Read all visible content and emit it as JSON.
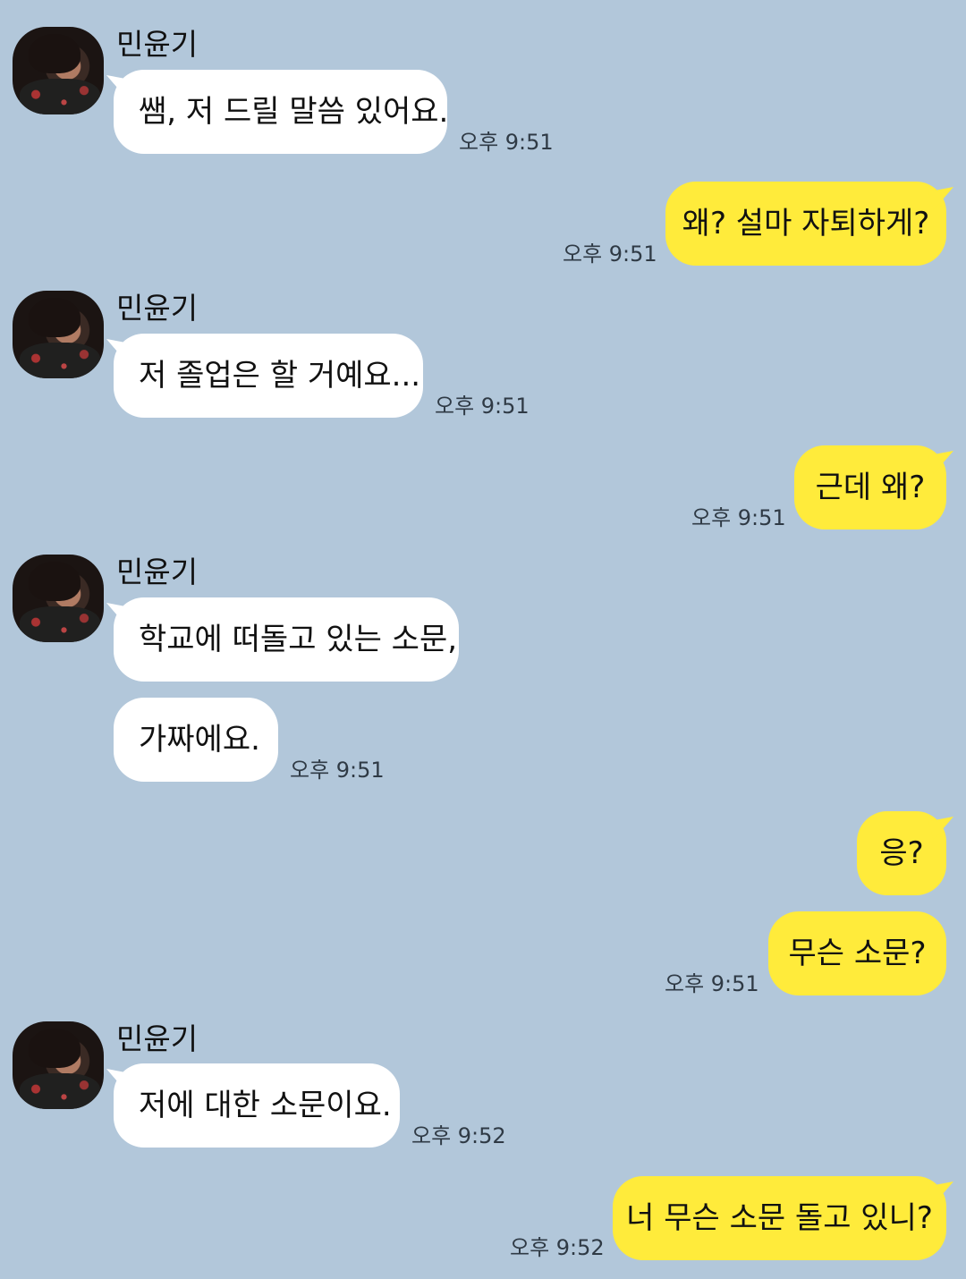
{
  "chat": {
    "contact_name": "민윤기",
    "messages": [
      {
        "sender": "민윤기",
        "text": "쌤, 저 드릴 말씀 있어요.",
        "time": "오후 9:51"
      },
      {
        "sender": "me",
        "text": "왜? 설마 자퇴하게?",
        "time": "오후 9:51"
      },
      {
        "sender": "민윤기",
        "text": "저 졸업은 할 거예요...",
        "time": "오후 9:51"
      },
      {
        "sender": "me",
        "text": "근데 왜?",
        "time": "오후 9:51"
      },
      {
        "sender": "민윤기",
        "text": "학교에 떠돌고 있는 소문,",
        "time": ""
      },
      {
        "sender": "민윤기",
        "text": "가짜에요.",
        "time": "오후 9:51"
      },
      {
        "sender": "me",
        "text": "응?",
        "time": ""
      },
      {
        "sender": "me",
        "text": "무슨 소문?",
        "time": "오후 9:51"
      },
      {
        "sender": "민윤기",
        "text": "저에 대한 소문이요.",
        "time": "오후 9:52"
      },
      {
        "sender": "me",
        "text": "너 무슨 소문 돌고 있니?",
        "time": "오후 9:52"
      }
    ]
  },
  "colors": {
    "background": "#b2c7da",
    "incoming_bubble": "#ffffff",
    "outgoing_bubble": "#ffeb3b"
  },
  "icons": {
    "avatar": "profile-photo"
  }
}
